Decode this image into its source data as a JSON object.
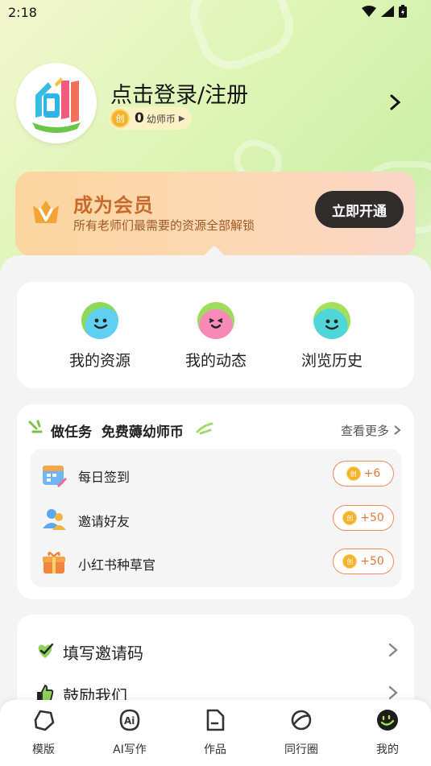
{
  "status_bar": {
    "time": "2:18",
    "icons": [
      "wifi-icon",
      "cell-signal-icon",
      "battery-icon"
    ]
  },
  "header": {
    "login_label": "点击登录/注册",
    "coin_glyph": "创",
    "coin_count": "0",
    "coin_unit": "幼师币"
  },
  "vip": {
    "title": "成为会员",
    "subtitle": "所有老师们最需要的资源全部解锁",
    "button": "立即开通",
    "colors": {
      "title": "#c9692c",
      "button_bg": "#2f2c2b"
    }
  },
  "quick_actions": [
    {
      "label": "我的资源",
      "icon": "smile-face-blue-icon"
    },
    {
      "label": "我的动态",
      "icon": "smile-face-pink-icon"
    },
    {
      "label": "浏览历史",
      "icon": "smile-face-cyan-icon"
    }
  ],
  "tasks": {
    "title": "做任务  免费薅幼师币",
    "more": "查看更多",
    "items": [
      {
        "label": "每日签到",
        "reward": "+6",
        "icon": "calendar-icon"
      },
      {
        "label": "邀请好友",
        "reward": "+50",
        "icon": "invite-friends-icon"
      },
      {
        "label": "小红书种草官",
        "reward": "+50",
        "icon": "gift-box-icon"
      }
    ]
  },
  "settings": [
    {
      "label": "填写邀请码",
      "icon": "check-heart-icon"
    },
    {
      "label": "鼓励我们",
      "icon": "thumbs-up-icon"
    }
  ],
  "tabbar": [
    {
      "label": "模版",
      "icon": "template-icon"
    },
    {
      "label": "AI写作",
      "icon": "ai-writing-icon"
    },
    {
      "label": "作品",
      "icon": "works-icon"
    },
    {
      "label": "同行圈",
      "icon": "planet-icon"
    },
    {
      "label": "我的",
      "icon": "profile-icon",
      "active": true
    }
  ],
  "colors": {
    "accent": "#e4783f",
    "background_green": "#d6f3b0",
    "coin": "#f4b22b"
  }
}
